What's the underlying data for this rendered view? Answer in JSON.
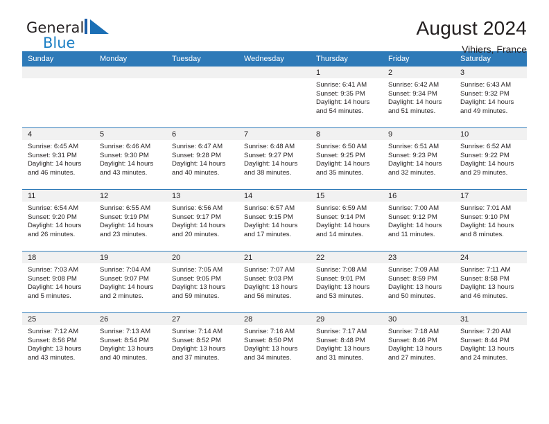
{
  "brand": {
    "name_part1": "General",
    "name_part2": "Blue",
    "mark_icon": "sail-triangle-icon"
  },
  "header": {
    "title": "August 2024",
    "location": "Vihiers, France"
  },
  "colors": {
    "header_blue": "#2e7ab8",
    "brand_blue": "#1b7fc4",
    "daynum_band": "#f1f1f1",
    "text": "#231f20"
  },
  "calendar": {
    "weekday_headers": [
      "Sunday",
      "Monday",
      "Tuesday",
      "Wednesday",
      "Thursday",
      "Friday",
      "Saturday"
    ],
    "weeks": [
      [
        {
          "day": "",
          "blank": true
        },
        {
          "day": "",
          "blank": true
        },
        {
          "day": "",
          "blank": true
        },
        {
          "day": "",
          "blank": true
        },
        {
          "day": "1",
          "sunrise": "Sunrise: 6:41 AM",
          "sunset": "Sunset: 9:35 PM",
          "daylight1": "Daylight: 14 hours",
          "daylight2": "and 54 minutes."
        },
        {
          "day": "2",
          "sunrise": "Sunrise: 6:42 AM",
          "sunset": "Sunset: 9:34 PM",
          "daylight1": "Daylight: 14 hours",
          "daylight2": "and 51 minutes."
        },
        {
          "day": "3",
          "sunrise": "Sunrise: 6:43 AM",
          "sunset": "Sunset: 9:32 PM",
          "daylight1": "Daylight: 14 hours",
          "daylight2": "and 49 minutes."
        }
      ],
      [
        {
          "day": "4",
          "sunrise": "Sunrise: 6:45 AM",
          "sunset": "Sunset: 9:31 PM",
          "daylight1": "Daylight: 14 hours",
          "daylight2": "and 46 minutes."
        },
        {
          "day": "5",
          "sunrise": "Sunrise: 6:46 AM",
          "sunset": "Sunset: 9:30 PM",
          "daylight1": "Daylight: 14 hours",
          "daylight2": "and 43 minutes."
        },
        {
          "day": "6",
          "sunrise": "Sunrise: 6:47 AM",
          "sunset": "Sunset: 9:28 PM",
          "daylight1": "Daylight: 14 hours",
          "daylight2": "and 40 minutes."
        },
        {
          "day": "7",
          "sunrise": "Sunrise: 6:48 AM",
          "sunset": "Sunset: 9:27 PM",
          "daylight1": "Daylight: 14 hours",
          "daylight2": "and 38 minutes."
        },
        {
          "day": "8",
          "sunrise": "Sunrise: 6:50 AM",
          "sunset": "Sunset: 9:25 PM",
          "daylight1": "Daylight: 14 hours",
          "daylight2": "and 35 minutes."
        },
        {
          "day": "9",
          "sunrise": "Sunrise: 6:51 AM",
          "sunset": "Sunset: 9:23 PM",
          "daylight1": "Daylight: 14 hours",
          "daylight2": "and 32 minutes."
        },
        {
          "day": "10",
          "sunrise": "Sunrise: 6:52 AM",
          "sunset": "Sunset: 9:22 PM",
          "daylight1": "Daylight: 14 hours",
          "daylight2": "and 29 minutes."
        }
      ],
      [
        {
          "day": "11",
          "sunrise": "Sunrise: 6:54 AM",
          "sunset": "Sunset: 9:20 PM",
          "daylight1": "Daylight: 14 hours",
          "daylight2": "and 26 minutes."
        },
        {
          "day": "12",
          "sunrise": "Sunrise: 6:55 AM",
          "sunset": "Sunset: 9:19 PM",
          "daylight1": "Daylight: 14 hours",
          "daylight2": "and 23 minutes."
        },
        {
          "day": "13",
          "sunrise": "Sunrise: 6:56 AM",
          "sunset": "Sunset: 9:17 PM",
          "daylight1": "Daylight: 14 hours",
          "daylight2": "and 20 minutes."
        },
        {
          "day": "14",
          "sunrise": "Sunrise: 6:57 AM",
          "sunset": "Sunset: 9:15 PM",
          "daylight1": "Daylight: 14 hours",
          "daylight2": "and 17 minutes."
        },
        {
          "day": "15",
          "sunrise": "Sunrise: 6:59 AM",
          "sunset": "Sunset: 9:14 PM",
          "daylight1": "Daylight: 14 hours",
          "daylight2": "and 14 minutes."
        },
        {
          "day": "16",
          "sunrise": "Sunrise: 7:00 AM",
          "sunset": "Sunset: 9:12 PM",
          "daylight1": "Daylight: 14 hours",
          "daylight2": "and 11 minutes."
        },
        {
          "day": "17",
          "sunrise": "Sunrise: 7:01 AM",
          "sunset": "Sunset: 9:10 PM",
          "daylight1": "Daylight: 14 hours",
          "daylight2": "and 8 minutes."
        }
      ],
      [
        {
          "day": "18",
          "sunrise": "Sunrise: 7:03 AM",
          "sunset": "Sunset: 9:08 PM",
          "daylight1": "Daylight: 14 hours",
          "daylight2": "and 5 minutes."
        },
        {
          "day": "19",
          "sunrise": "Sunrise: 7:04 AM",
          "sunset": "Sunset: 9:07 PM",
          "daylight1": "Daylight: 14 hours",
          "daylight2": "and 2 minutes."
        },
        {
          "day": "20",
          "sunrise": "Sunrise: 7:05 AM",
          "sunset": "Sunset: 9:05 PM",
          "daylight1": "Daylight: 13 hours",
          "daylight2": "and 59 minutes."
        },
        {
          "day": "21",
          "sunrise": "Sunrise: 7:07 AM",
          "sunset": "Sunset: 9:03 PM",
          "daylight1": "Daylight: 13 hours",
          "daylight2": "and 56 minutes."
        },
        {
          "day": "22",
          "sunrise": "Sunrise: 7:08 AM",
          "sunset": "Sunset: 9:01 PM",
          "daylight1": "Daylight: 13 hours",
          "daylight2": "and 53 minutes."
        },
        {
          "day": "23",
          "sunrise": "Sunrise: 7:09 AM",
          "sunset": "Sunset: 8:59 PM",
          "daylight1": "Daylight: 13 hours",
          "daylight2": "and 50 minutes."
        },
        {
          "day": "24",
          "sunrise": "Sunrise: 7:11 AM",
          "sunset": "Sunset: 8:58 PM",
          "daylight1": "Daylight: 13 hours",
          "daylight2": "and 46 minutes."
        }
      ],
      [
        {
          "day": "25",
          "sunrise": "Sunrise: 7:12 AM",
          "sunset": "Sunset: 8:56 PM",
          "daylight1": "Daylight: 13 hours",
          "daylight2": "and 43 minutes."
        },
        {
          "day": "26",
          "sunrise": "Sunrise: 7:13 AM",
          "sunset": "Sunset: 8:54 PM",
          "daylight1": "Daylight: 13 hours",
          "daylight2": "and 40 minutes."
        },
        {
          "day": "27",
          "sunrise": "Sunrise: 7:14 AM",
          "sunset": "Sunset: 8:52 PM",
          "daylight1": "Daylight: 13 hours",
          "daylight2": "and 37 minutes."
        },
        {
          "day": "28",
          "sunrise": "Sunrise: 7:16 AM",
          "sunset": "Sunset: 8:50 PM",
          "daylight1": "Daylight: 13 hours",
          "daylight2": "and 34 minutes."
        },
        {
          "day": "29",
          "sunrise": "Sunrise: 7:17 AM",
          "sunset": "Sunset: 8:48 PM",
          "daylight1": "Daylight: 13 hours",
          "daylight2": "and 31 minutes."
        },
        {
          "day": "30",
          "sunrise": "Sunrise: 7:18 AM",
          "sunset": "Sunset: 8:46 PM",
          "daylight1": "Daylight: 13 hours",
          "daylight2": "and 27 minutes."
        },
        {
          "day": "31",
          "sunrise": "Sunrise: 7:20 AM",
          "sunset": "Sunset: 8:44 PM",
          "daylight1": "Daylight: 13 hours",
          "daylight2": "and 24 minutes."
        }
      ]
    ]
  }
}
